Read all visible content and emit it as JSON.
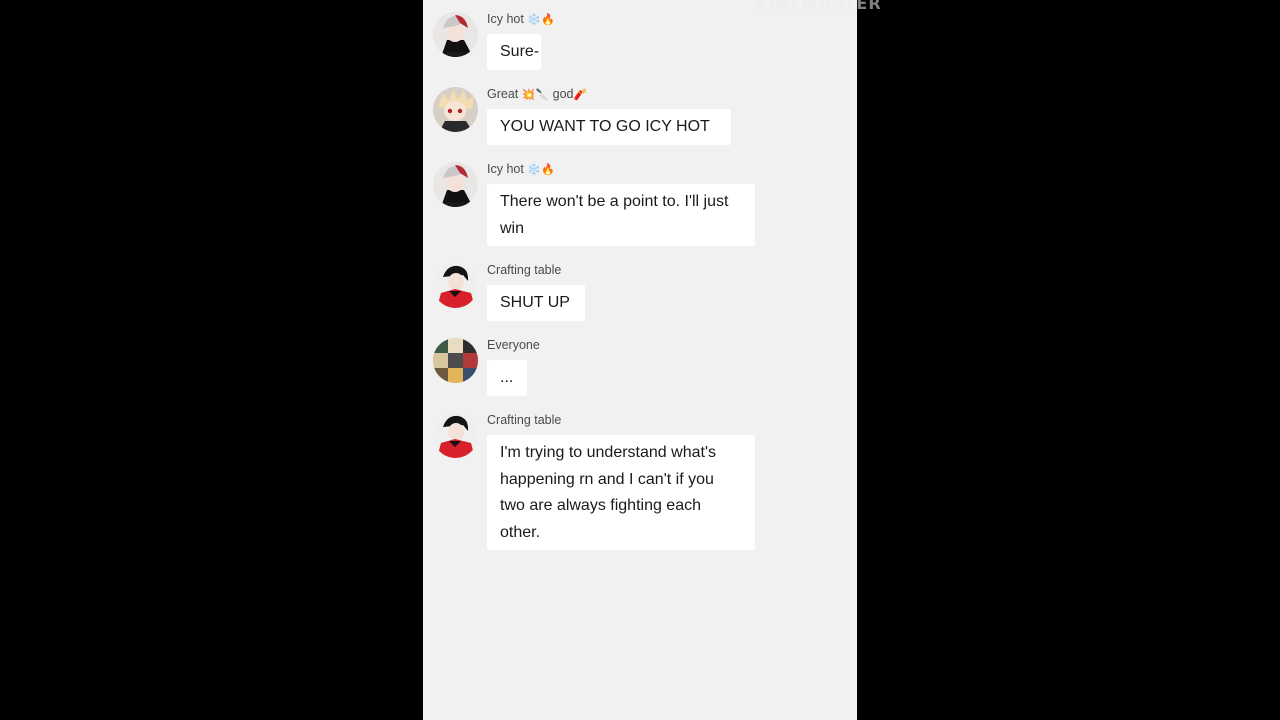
{
  "watermark": "KINEMASTER",
  "messages": [
    {
      "sender": "Icy hot",
      "sender_emoji": "❄️🔥",
      "text": "Sure-"
    },
    {
      "sender": "Great",
      "sender_emoji": "💥🔪",
      "sender_suffix": "god",
      "sender_suffix_emoji": "🧨",
      "text": "YOU WANT TO GO ICY HOT"
    },
    {
      "sender": "Icy hot",
      "sender_emoji": "❄️🔥",
      "text": "There won't be a point to. I'll just win"
    },
    {
      "sender": "Crafting table",
      "text": "SHUT UP"
    },
    {
      "sender": "Everyone",
      "text": "..."
    },
    {
      "sender": "Crafting table",
      "text": "I'm trying to understand what's happening rn and I can't if you two are always fighting each other."
    }
  ],
  "colors": {
    "background": "#000000",
    "chat_background": "#f2f1f1",
    "bubble": "#ffffff",
    "text": "#1a1a1a"
  }
}
